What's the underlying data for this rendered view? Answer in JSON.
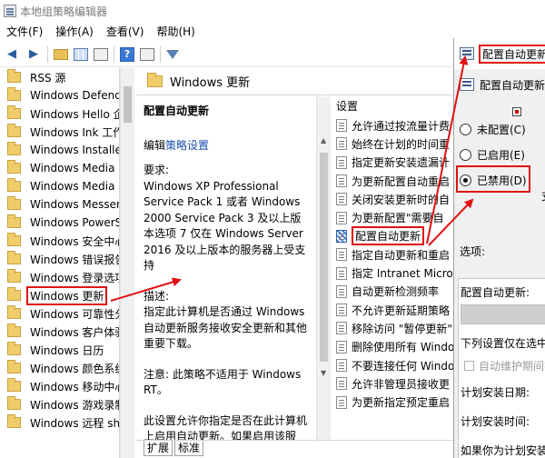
{
  "window": {
    "title": "本地组策略编辑器"
  },
  "menu": [
    "文件(F)",
    "操作(A)",
    "查看(V)",
    "帮助(H)"
  ],
  "tree": {
    "items": [
      "RSS 源",
      "Windows Defend",
      "Windows Hello 企",
      "Windows Ink 工作",
      "Windows Installe",
      "Windows Media I",
      "Windows Media F",
      "Windows Messen",
      "Windows PowerS",
      "Windows 安全中心",
      "Windows 错误报告",
      "Windows 登录选项",
      "Windows 更新",
      "Windows 可靠性分",
      "Windows 客户体验",
      "Windows 日历",
      "Windows 颜色系统",
      "Windows 移动中心",
      "Windows 游戏录制",
      "Windows 远程 sh"
    ],
    "selected_index": 12
  },
  "middle": {
    "header": "Windows 更新",
    "desc_title": "配置自动更新",
    "edit_prefix": "编辑",
    "edit_link": "策略设置",
    "requirements": "要求:\nWindows XP Professional Service Pack 1 或者 Windows 2000 Service Pack 3 及以上版本选项 7 仅在 Windows Server 2016 及以上版本的服务器上受支持",
    "description": "描述:\n指定此计算机是否通过 Windows 自动更新服务接收安全更新和其他重要下载。",
    "note": "注意: 此策略不适用于 Windows RT。",
    "more": "此设置允许你指定是否在此计算机上启用自动更新。如果启用该服"
  },
  "settings": {
    "header": "设置",
    "items": [
      "允许通过按流量计费",
      "始终在计划的时间重",
      "指定更新安装遗漏计",
      "为更新配置自动重启",
      "关闭安装更新时的自",
      "为更新配置\"需要自",
      "配置自动更新",
      "指定自动更新和重启",
      "指定 Intranet Micro",
      "自动更新检测频率",
      "不允许更新延期策略",
      "移除访问 \"暂停更新\"",
      "删除使用所有 Windo",
      "不要连接任何 Windo",
      "允许非管理员接收更",
      "为更新指定预定重启"
    ],
    "selected_index": 6
  },
  "tabs": [
    "扩展",
    "标准"
  ],
  "dialog": {
    "title": "配置自动更新",
    "heading": "配置自动更新",
    "radio_not_configured": "未配置(C)",
    "radio_enabled": "已启用(E)",
    "radio_disabled": "已禁用(D)",
    "side_char": "支",
    "options_label": "选项:",
    "opt_configure": "配置自动更新:",
    "opt_note": "下列设置仅在选中",
    "opt_checkbox": "自动维护期间拉",
    "opt_day": "计划安装日期:",
    "opt_time": "计划安装时间:",
    "opt_more": "如果你为计划安装"
  }
}
